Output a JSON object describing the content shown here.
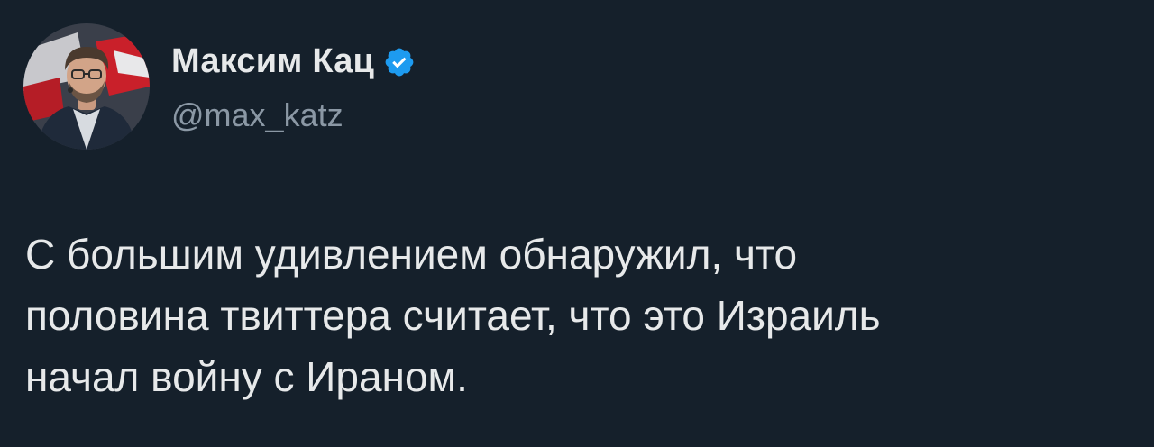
{
  "author": {
    "display_name": "Максим Кац",
    "handle": "@max_katz",
    "verified_icon": "verified-badge-icon",
    "verified_color": "#1d9bf0"
  },
  "tweet": {
    "text": "С большим удивлением обнаружил, что\nполовина твиттера считает, что это Израиль\nначал войну с Ираном."
  },
  "colors": {
    "background": "#15202b",
    "text": "#e7e9ea",
    "secondary_text": "#8b98a5"
  }
}
